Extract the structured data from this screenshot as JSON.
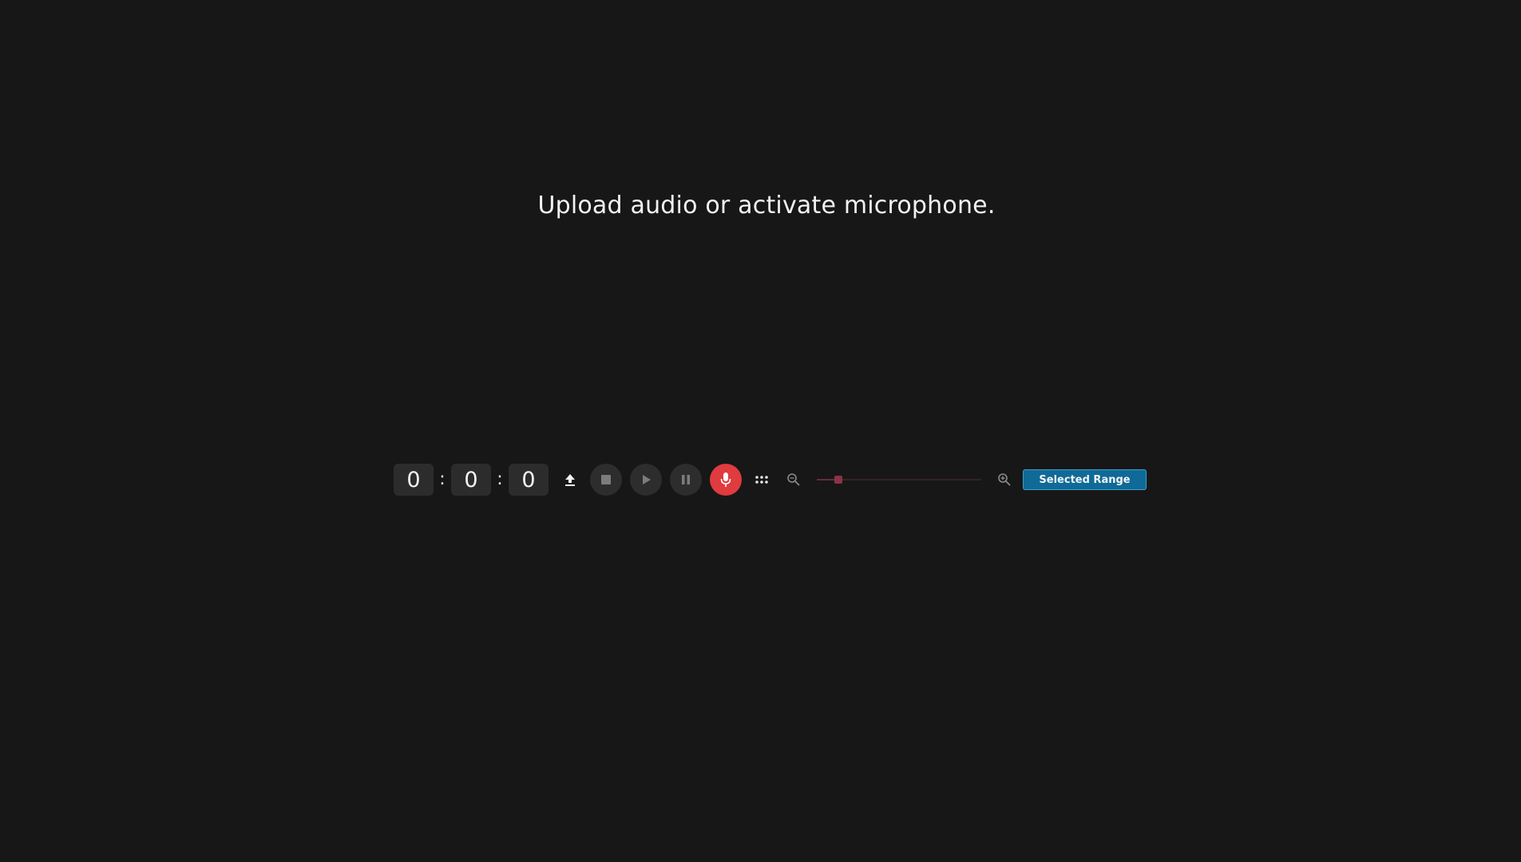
{
  "prompt": {
    "message": "Upload audio or activate microphone."
  },
  "timer": {
    "hours": "0",
    "minutes": "0",
    "seconds": "0",
    "separator": ":"
  },
  "toolbar": {
    "icons": {
      "upload": "upload-icon",
      "stop": "stop-icon",
      "play": "play-icon",
      "pause": "pause-icon",
      "microphone": "microphone-icon",
      "grid": "grid-dots-icon",
      "zoom_out": "zoom-out-icon",
      "zoom_in": "zoom-in-icon"
    },
    "zoom_level": 0.13,
    "range_label": "Selected Range"
  },
  "colors": {
    "background": "#171717",
    "mic_active": "#e03b3f",
    "range_button": "#0f6a97",
    "slider_accent": "#8a3447"
  }
}
